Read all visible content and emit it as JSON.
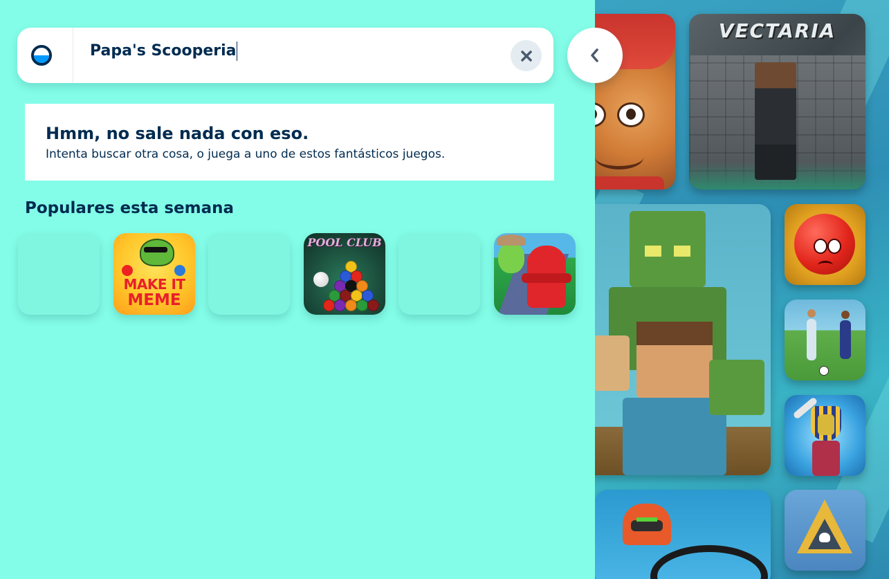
{
  "search": {
    "query": "Papa's Scooperia",
    "clear_label": "×",
    "back_label": "‹"
  },
  "no_results": {
    "title": "Hmm, no sale nada con eso.",
    "message": "Intenta buscar otra cosa, o juega a uno de estos fantásticos juegos."
  },
  "popular": {
    "title": "Populares esta semana",
    "tiles": [
      {
        "icon": "loading-placeholder"
      },
      {
        "icon": "make-it-meme-thumbnail",
        "text_line1": "MAKE IT",
        "text_line2": "MEME"
      },
      {
        "icon": "loading-placeholder"
      },
      {
        "icon": "pool-club-thumbnail",
        "logo": "POOL CLUB"
      },
      {
        "icon": "loading-placeholder"
      },
      {
        "icon": "hydrant-runner-thumbnail"
      }
    ]
  },
  "background_games": {
    "vectaria_title": "VECTARIA",
    "tiles": [
      "subway-runner-thumbnail",
      "vectaria-thumbnail",
      "zombie-blocks-thumbnail",
      "red-ball-thumbnail",
      "soccer-thumbnail",
      "pharaoh-thumbnail",
      "moto-thumbnail",
      "warning-sign-thumbnail"
    ]
  },
  "colors": {
    "panel_bg": "#83fde7",
    "text_dark": "#002b50",
    "accent_blue": "#0099ff",
    "clear_button_bg": "#e4ecf1"
  }
}
